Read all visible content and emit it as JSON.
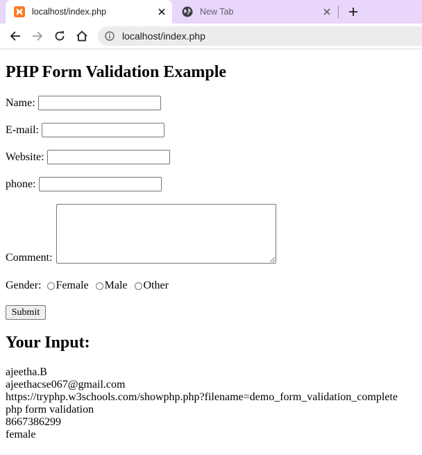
{
  "browser": {
    "tabs": [
      {
        "title": "localhost/index.php",
        "icon": "xampp-icon",
        "active": true
      },
      {
        "title": "New Tab",
        "icon": "globe-icon",
        "active": false
      }
    ],
    "url": "localhost/index.php"
  },
  "page": {
    "heading": "PHP Form Validation Example",
    "form": {
      "name_label": "Name:",
      "email_label": "E-mail:",
      "website_label": "Website:",
      "phone_label": "phone:",
      "comment_label": "Comment:",
      "gender_label": "Gender:",
      "gender_options": [
        "Female",
        "Male",
        "Other"
      ],
      "submit_label": "Submit",
      "values": {
        "name": "",
        "email": "",
        "website": "",
        "phone": "",
        "comment": ""
      }
    },
    "output_heading": "Your Input:",
    "output_lines": [
      "ajeetha.B",
      "ajeethacse067@gmail.com",
      "https://tryphp.w3schools.com/showphp.php?filename=demo_form_validation_complete",
      "php form validation",
      "8667386299",
      "female"
    ]
  },
  "colors": {
    "tabstrip": "#e8d6fb",
    "favicon_orange": "#fb7a24",
    "omnibox": "#ececec"
  }
}
